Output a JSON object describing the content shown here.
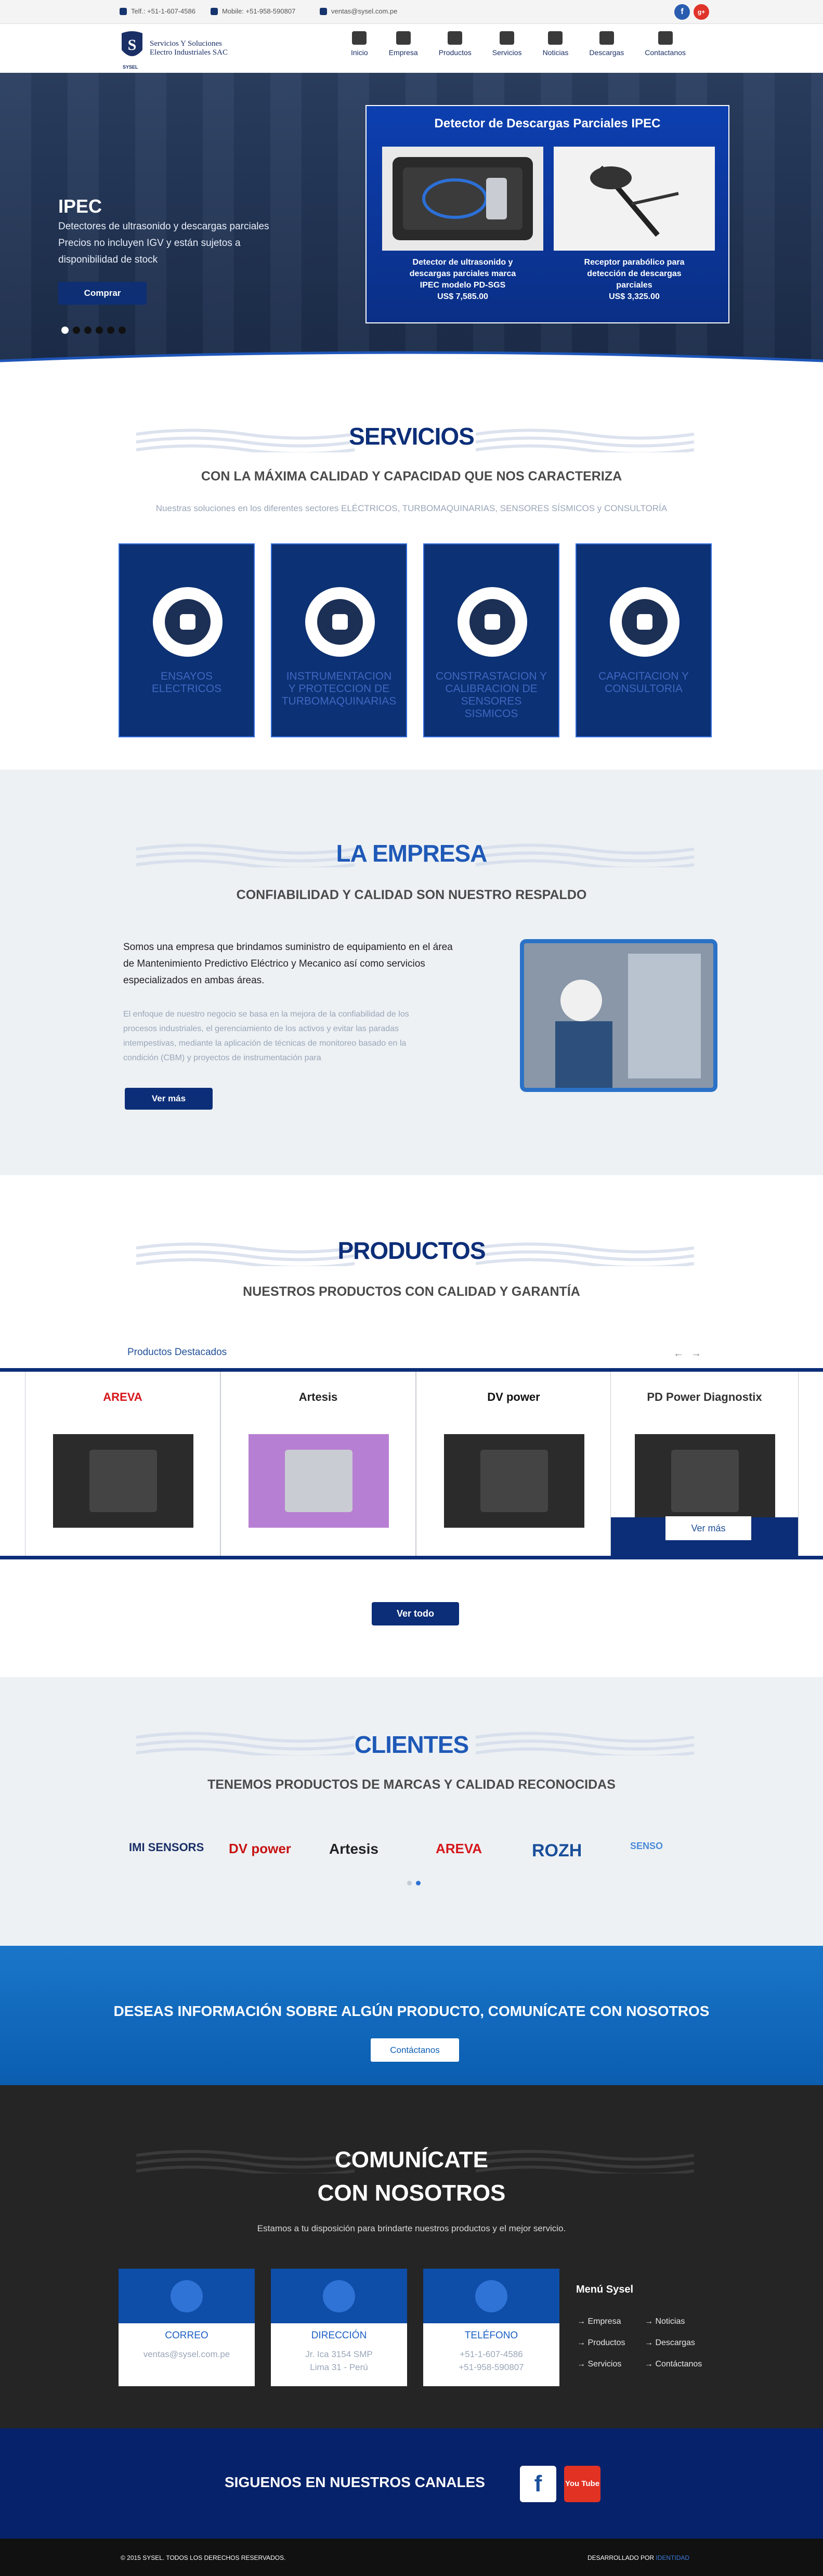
{
  "topbar": {
    "phone": "Telf.: +51-1-607-4586",
    "mobile": "Mobile: +51-958-590807",
    "email": "ventas@sysel.com.pe",
    "facebook_glyph": "f",
    "google_glyph": "g+"
  },
  "header": {
    "logo_initials": "S",
    "logo_line1": "Servicios Y Soluciones",
    "logo_line2": "Electro Industriales SAC",
    "logo_sub": "SYSEL",
    "nav": [
      {
        "label": "Inicio",
        "icon": "home-icon"
      },
      {
        "label": "Empresa",
        "icon": "building-icon"
      },
      {
        "label": "Productos",
        "icon": "tag-icon"
      },
      {
        "label": "Servicios",
        "icon": "car-icon"
      },
      {
        "label": "Noticias",
        "icon": "newspaper-icon"
      },
      {
        "label": "Descargas",
        "icon": "cloud-download-icon"
      },
      {
        "label": "Contactanos",
        "icon": "chat-icon"
      }
    ]
  },
  "hero": {
    "title": "IPEC",
    "lines": [
      "Detectores de ultrasonido y descargas parciales",
      "Precios no incluyen IGV y están sujetos a",
      "disponibilidad de stock"
    ],
    "button": "Comprar",
    "slide_count": 6,
    "active_slide": 0,
    "promo": {
      "title": "Detector de Descargas Parciales IPEC",
      "item1": [
        "Detector de ultrasonido y",
        "descargas parciales marca",
        "IPEC modelo PD-SGS",
        "US$ 7,585.00"
      ],
      "item2": [
        "Receptor parabólico para",
        "detección de descargas",
        "parciales",
        "US$ 3,325.00"
      ]
    }
  },
  "servicios": {
    "title": "SERVICIOS",
    "subtitle": "CON LA MÁXIMA CALIDAD Y CAPACIDAD QUE NOS CARACTERIZA",
    "desc": "Nuestras soluciones en los diferentes sectores ELÉCTRICOS, TURBOMAQUINARIAS, SENSORES SÍSMICOS y CONSULTORÍA",
    "cards": [
      {
        "label": "ENSAYOS ELECTRICOS",
        "icon": "plug-icon"
      },
      {
        "label": "INSTRUMENTACION Y PROTECCION DE TURBOMAQUINARIAS",
        "icon": "drill-icon"
      },
      {
        "label": "CONSTRASTACION Y CALIBRACION DE SENSORES SISMICOS",
        "icon": "monitor-icon"
      },
      {
        "label": "CAPACITACION Y CONSULTORIA",
        "icon": "person-chat-icon"
      }
    ]
  },
  "empresa": {
    "title": "LA EMPRESA",
    "subtitle": "CONFIABILIDAD Y CALIDAD SON NUESTRO RESPALDO",
    "text1": "Somos una empresa que brindamos suministro de equipamiento en el área de Mantenimiento Predictivo Eléctrico y Mecanico así como servicios especializados en ambas áreas.",
    "text2": "El enfoque de nuestro negocio se basa en la mejora de la confiabilidad de los procesos industriales, el gerenciamiento de los activos y evitar las paradas intempestivas, mediante la aplicación de técnicas de monitoreo basado en la condición (CBM) y proyectos de instrumentación para",
    "button": "Ver más"
  },
  "productos": {
    "title": "PRODUCTOS",
    "subtitle": "NUESTROS PRODUCTOS CON CALIDAD Y GARANTÍA",
    "featured": "Productos Destacados",
    "prev": "←",
    "next": "→",
    "items": [
      {
        "brand": "AREVA",
        "color": "#d6161b"
      },
      {
        "brand": "Artesis",
        "color": "#222222"
      },
      {
        "brand": "DV power",
        "color": "#111111"
      },
      {
        "brand": "PD Power Diagnostix",
        "color": "#333333"
      }
    ],
    "hover_button": "Ver más",
    "ver_todo": "Ver todo"
  },
  "clientes": {
    "title": "CLIENTES",
    "subtitle": "TENEMOS PRODUCTOS DE MARCAS Y CALIDAD RECONOCIDAS",
    "logos": [
      "IMI SENSORS",
      "DV power",
      "Artesis",
      "AREVA",
      "ROZH",
      "SENSO"
    ],
    "pages": 2,
    "active_page": 1
  },
  "cta": {
    "title": "DESEAS INFORMACIÓN SOBRE ALGÚN PRODUCTO, COMUNÍCATE CON NOSOTROS",
    "button": "Contáctanos"
  },
  "contact": {
    "title1": "COMUNÍCATE",
    "title2": "CON NOSOTROS",
    "subtitle": "Estamos a tu disposición para brindarte nuestros productos y el mejor servicio.",
    "cards": [
      {
        "label": "CORREO",
        "lines": [
          "ventas@sysel.com.pe"
        ],
        "icon": "mail-icon"
      },
      {
        "label": "DIRECCIÓN",
        "lines": [
          "Jr. Ica 3154 SMP",
          "Lima 31 - Perú"
        ],
        "icon": "location-icon"
      },
      {
        "label": "TELÉFONO",
        "lines": [
          "+51-1-607-4586",
          "+51-958-590807"
        ],
        "icon": "phone-icon"
      }
    ],
    "menu_title": "Menú Sysel",
    "menu": [
      "Empresa",
      "Noticias",
      "Productos",
      "Descargas",
      "Servicios",
      "Contáctanos"
    ]
  },
  "follow": {
    "title": "SIGUENOS EN NUESTROS CANALES",
    "facebook": "f",
    "youtube": "You Tube"
  },
  "footer": {
    "copyright": "© 2015 SYSEL. TODOS LOS DERECHOS RESERVADOS.",
    "dev_prefix": "DESARROLLADO POR",
    "dev_name": "IDENTIDAD"
  },
  "colors": {
    "brand": "#0c2e78",
    "accent": "#1b5fc4",
    "dark": "#252525"
  }
}
